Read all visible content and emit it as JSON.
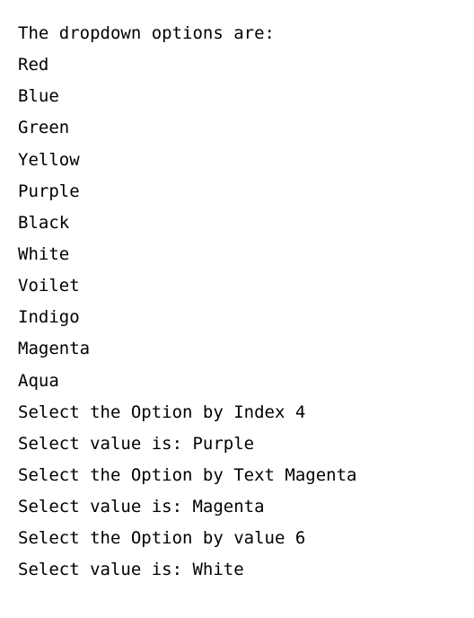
{
  "header": "The dropdown options are:",
  "options": [
    "Red",
    "Blue",
    "Green",
    "Yellow",
    "Purple",
    "Black",
    "White",
    "Voilet",
    "Indigo",
    "Magenta",
    "Aqua"
  ],
  "results": [
    "Select the Option by Index 4",
    "Select value is: Purple",
    "Select the Option by Text Magenta",
    "Select value is: Magenta",
    "Select the Option by value 6",
    "Select value is: White"
  ]
}
